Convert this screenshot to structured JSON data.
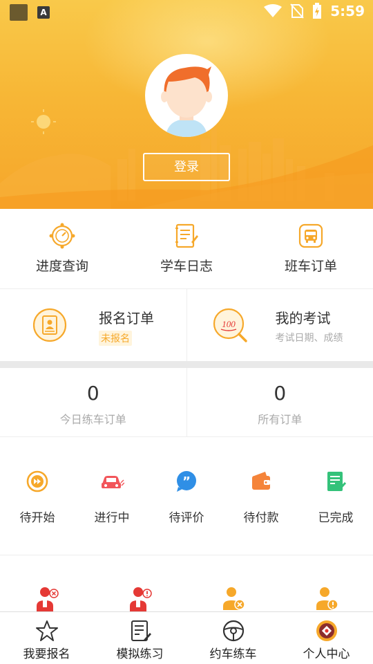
{
  "status_bar": {
    "time": "5:59"
  },
  "profile": {
    "login_label": "登录"
  },
  "features": [
    {
      "label": "进度查询",
      "icon": "progress-icon"
    },
    {
      "label": "学车日志",
      "icon": "journal-icon"
    },
    {
      "label": "班车订单",
      "icon": "shuttle-bus-icon"
    }
  ],
  "registration_order": {
    "title": "报名订单",
    "badge": "未报名"
  },
  "my_exam": {
    "title": "我的考试",
    "subtitle": "考试日期、成绩"
  },
  "counts": [
    {
      "value": "0",
      "label": "今日练车订单"
    },
    {
      "value": "0",
      "label": "所有订单"
    }
  ],
  "order_status": [
    {
      "label": "待开始",
      "icon": "fast-forward-icon"
    },
    {
      "label": "进行中",
      "icon": "car-icon"
    },
    {
      "label": "待评价",
      "icon": "comment-icon"
    },
    {
      "label": "待付款",
      "icon": "wallet-icon"
    },
    {
      "label": "已完成",
      "icon": "completed-doc-icon"
    }
  ],
  "bottom_nav": [
    {
      "label": "我要报名",
      "icon": "star-icon"
    },
    {
      "label": "模拟练习",
      "icon": "practice-icon"
    },
    {
      "label": "约车练车",
      "icon": "steering-wheel-icon"
    },
    {
      "label": "个人中心",
      "icon": "personal-center-icon"
    }
  ],
  "colors": {
    "accent": "#f6a82a",
    "header_top": "#f9c94a",
    "header_bottom": "#f6a62a"
  }
}
